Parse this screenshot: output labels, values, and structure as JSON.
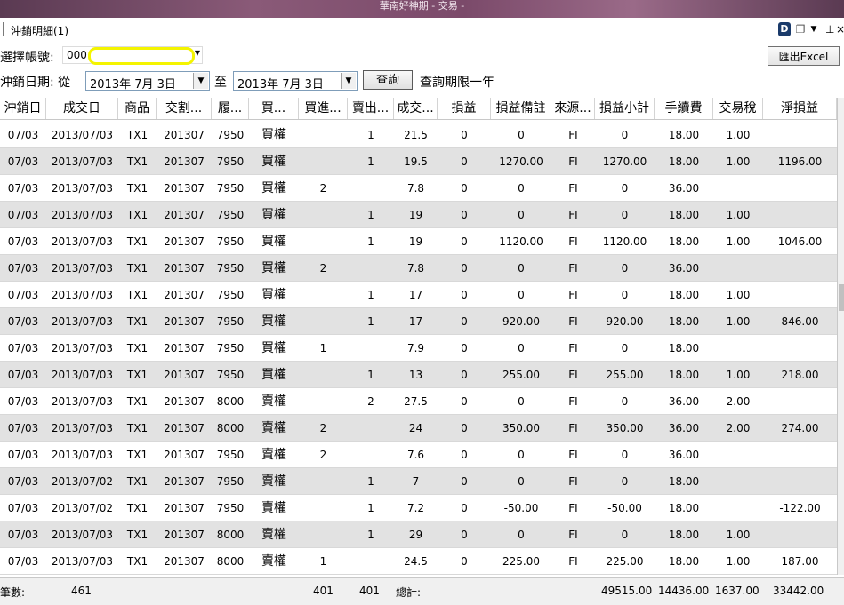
{
  "app": {
    "title": "華南好神期 - 交易 -"
  },
  "panel": {
    "title": "沖銷明細(1)"
  },
  "filters": {
    "account_label": "選擇帳號:",
    "account_value": "000",
    "date_label": "沖銷日期: 從",
    "date_from": "2013年  7月  3日",
    "to_label": "至",
    "date_to": "2013年  7月  3日",
    "query_button": "查詢",
    "query_note": "查詢期限一年",
    "export_button": "匯出Excel"
  },
  "table": {
    "columns": [
      "沖銷日",
      "成交日",
      "商品",
      "交割...",
      "履...",
      "買...",
      "買進...",
      "賣出...",
      "成交...",
      "損益",
      "損益備註",
      "來源...",
      "損益小計",
      "手續費",
      "交易稅",
      "淨損益"
    ],
    "rows": [
      [
        "07/03",
        "2013/07/03",
        "TX1",
        "201307",
        "7950",
        "買權",
        "",
        "1",
        "21.5",
        "0",
        "0",
        "FI",
        "0",
        "18.00",
        "1.00",
        ""
      ],
      [
        "07/03",
        "2013/07/03",
        "TX1",
        "201307",
        "7950",
        "買權",
        "",
        "1",
        "19.5",
        "0",
        "1270.00",
        "FI",
        "1270.00",
        "18.00",
        "1.00",
        "1196.00"
      ],
      [
        "07/03",
        "2013/07/03",
        "TX1",
        "201307",
        "7950",
        "買權",
        "2",
        "",
        "7.8",
        "0",
        "0",
        "FI",
        "0",
        "36.00",
        "",
        ""
      ],
      [
        "07/03",
        "2013/07/03",
        "TX1",
        "201307",
        "7950",
        "買權",
        "",
        "1",
        "19",
        "0",
        "0",
        "FI",
        "0",
        "18.00",
        "1.00",
        ""
      ],
      [
        "07/03",
        "2013/07/03",
        "TX1",
        "201307",
        "7950",
        "買權",
        "",
        "1",
        "19",
        "0",
        "1120.00",
        "FI",
        "1120.00",
        "18.00",
        "1.00",
        "1046.00"
      ],
      [
        "07/03",
        "2013/07/03",
        "TX1",
        "201307",
        "7950",
        "買權",
        "2",
        "",
        "7.8",
        "0",
        "0",
        "FI",
        "0",
        "36.00",
        "",
        ""
      ],
      [
        "07/03",
        "2013/07/03",
        "TX1",
        "201307",
        "7950",
        "買權",
        "",
        "1",
        "17",
        "0",
        "0",
        "FI",
        "0",
        "18.00",
        "1.00",
        ""
      ],
      [
        "07/03",
        "2013/07/03",
        "TX1",
        "201307",
        "7950",
        "買權",
        "",
        "1",
        "17",
        "0",
        "920.00",
        "FI",
        "920.00",
        "18.00",
        "1.00",
        "846.00"
      ],
      [
        "07/03",
        "2013/07/03",
        "TX1",
        "201307",
        "7950",
        "買權",
        "1",
        "",
        "7.9",
        "0",
        "0",
        "FI",
        "0",
        "18.00",
        "",
        ""
      ],
      [
        "07/03",
        "2013/07/03",
        "TX1",
        "201307",
        "7950",
        "買權",
        "",
        "1",
        "13",
        "0",
        "255.00",
        "FI",
        "255.00",
        "18.00",
        "1.00",
        "218.00"
      ],
      [
        "07/03",
        "2013/07/03",
        "TX1",
        "201307",
        "8000",
        "賣權",
        "",
        "2",
        "27.5",
        "0",
        "0",
        "FI",
        "0",
        "36.00",
        "2.00",
        ""
      ],
      [
        "07/03",
        "2013/07/03",
        "TX1",
        "201307",
        "8000",
        "賣權",
        "2",
        "",
        "24",
        "0",
        "350.00",
        "FI",
        "350.00",
        "36.00",
        "2.00",
        "274.00"
      ],
      [
        "07/03",
        "2013/07/03",
        "TX1",
        "201307",
        "7950",
        "賣權",
        "2",
        "",
        "7.6",
        "0",
        "0",
        "FI",
        "0",
        "36.00",
        "",
        ""
      ],
      [
        "07/03",
        "2013/07/02",
        "TX1",
        "201307",
        "7950",
        "賣權",
        "",
        "1",
        "7",
        "0",
        "0",
        "FI",
        "0",
        "18.00",
        "",
        ""
      ],
      [
        "07/03",
        "2013/07/02",
        "TX1",
        "201307",
        "7950",
        "賣權",
        "",
        "1",
        "7.2",
        "0",
        "-50.00",
        "FI",
        "-50.00",
        "18.00",
        "",
        "-122.00"
      ],
      [
        "07/03",
        "2013/07/03",
        "TX1",
        "201307",
        "8000",
        "賣權",
        "",
        "1",
        "29",
        "0",
        "0",
        "FI",
        "0",
        "18.00",
        "1.00",
        ""
      ],
      [
        "07/03",
        "2013/07/03",
        "TX1",
        "201307",
        "8000",
        "賣權",
        "1",
        "",
        "24.5",
        "0",
        "225.00",
        "FI",
        "225.00",
        "18.00",
        "1.00",
        "187.00"
      ]
    ]
  },
  "footer": {
    "count_label": "筆數:",
    "count_value": "461",
    "buy_total": "401",
    "sell_total": "401",
    "total_label": "總計:",
    "pnl_subtotal": "49515.00",
    "fee_total": "14436.00",
    "tax_total": "1637.00",
    "net_total": "33442.00"
  }
}
